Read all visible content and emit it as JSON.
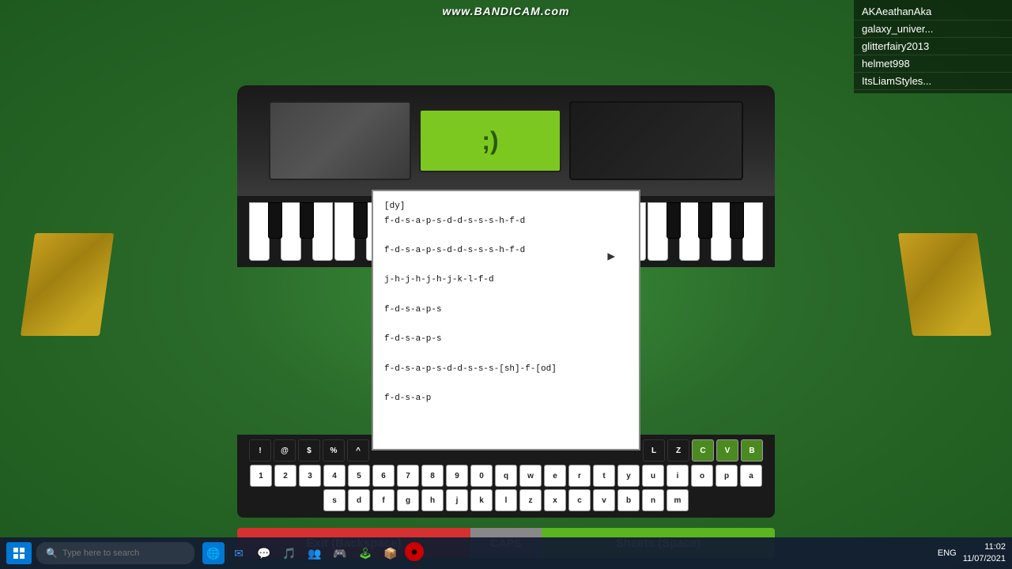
{
  "watermark": {
    "text": "www.BANDICAM.com"
  },
  "players": {
    "list": [
      "AKAeathanAka",
      "galaxy_univer...",
      "glitterfairy2013",
      "helmet998",
      "ItsLiamStyles..."
    ]
  },
  "piano": {
    "display_text": ";)"
  },
  "sheet": {
    "lines": [
      "[dy]",
      "f-d-s-a-p-s-d-d-s-s-s-h-f-d",
      "",
      "f-d-s-a-p-s-d-d-s-s-s-h-f-d",
      "",
      "j-h-j-h-j-h-j-k-l-f-d",
      "",
      "f-d-s-a-p-s",
      "",
      "f-d-s-a-p-s",
      "",
      "f-d-s-a-p-s-d-d-s-s-s-[sh]-f-[od]",
      "",
      "f-d-s-a-p"
    ]
  },
  "buttons": {
    "exit_label": "Exit (Backspace)",
    "caps_label": "CAPS",
    "sheets_label": "Sheets (Space)"
  },
  "keyboard": {
    "top_row_black": [
      "!",
      "@",
      "$",
      "%",
      "^"
    ],
    "top_row_right_black": [
      "L",
      "Z",
      "C",
      "V",
      "B"
    ],
    "bottom_row": [
      "1",
      "2",
      "3",
      "4",
      "5",
      "6",
      "7",
      "8",
      "9",
      "0",
      "q",
      "w",
      "e",
      "r",
      "t",
      "y",
      "u",
      "i",
      "o",
      "p",
      "a",
      "s",
      "d",
      "f",
      "g",
      "h",
      "j",
      "k",
      "l",
      "z",
      "x",
      "c",
      "v",
      "b",
      "n",
      "m"
    ]
  },
  "taskbar": {
    "search_placeholder": "Type here to search",
    "time": "11:02",
    "date": "11/07/2021",
    "lang": "ENG"
  }
}
